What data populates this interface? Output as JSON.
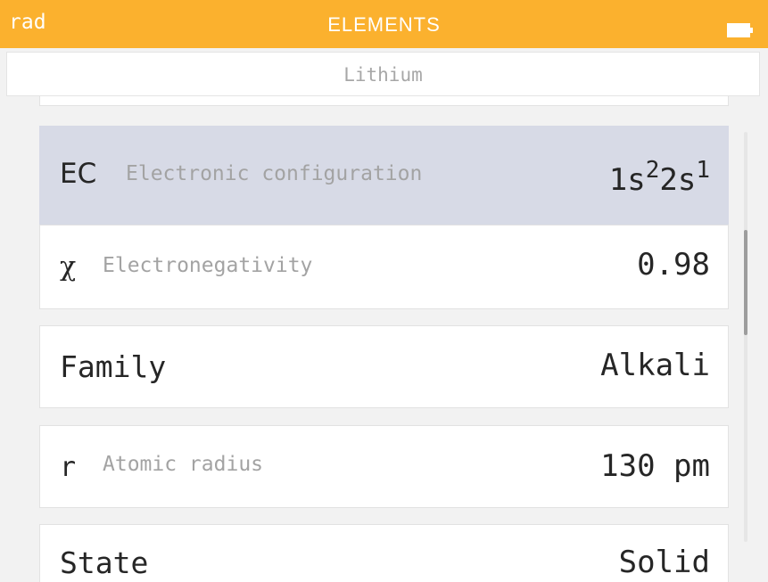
{
  "header": {
    "angle_unit": "rad",
    "title": "ELEMENTS",
    "battery_icon": "battery-full-icon"
  },
  "element": {
    "name": "Lithium"
  },
  "properties": [
    {
      "symbol": "EC",
      "description": "Electronic configuration",
      "value_parts": [
        "1s",
        "2",
        "2s",
        "1"
      ],
      "selected": true
    },
    {
      "symbol": "χ",
      "description": "Electronegativity",
      "value": "0.98",
      "selected": false
    },
    {
      "symbol": "Family",
      "description": "",
      "value": "Alkali",
      "selected": false
    },
    {
      "symbol": "r",
      "description": "Atomic radius",
      "value": "130 pm",
      "selected": false
    },
    {
      "symbol": "State",
      "description": "",
      "value": "Solid",
      "selected": false
    }
  ],
  "colors": {
    "header_bg": "#fbb12e",
    "selected_row_bg": "#d7dae6",
    "primary_text": "#262626",
    "secondary_text": "#a3a3a3"
  }
}
